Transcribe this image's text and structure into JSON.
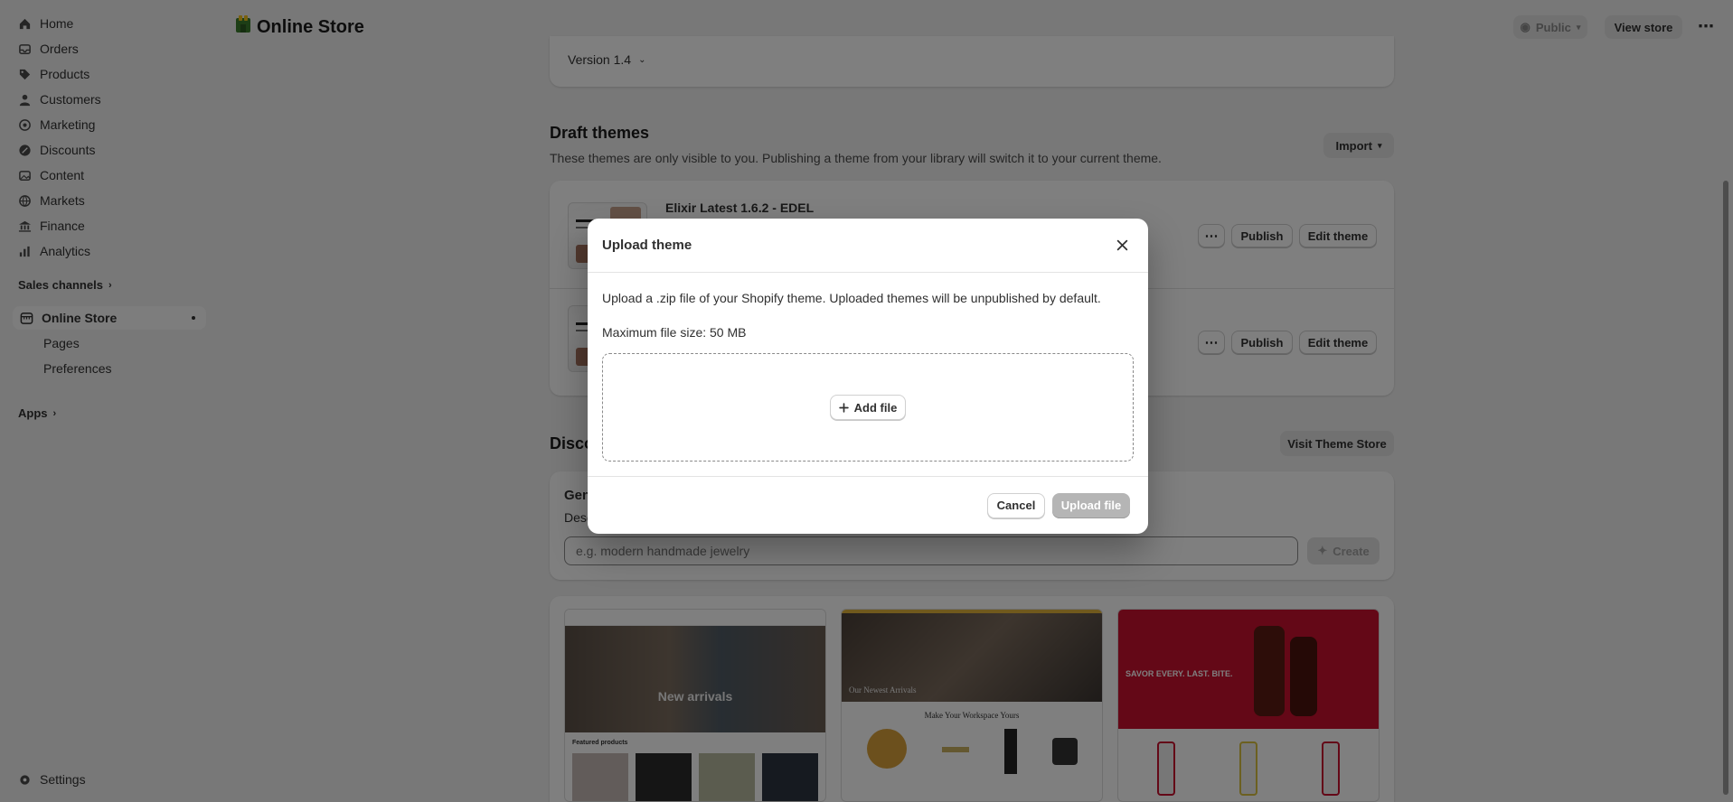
{
  "sidebar": {
    "items": [
      {
        "label": "Home",
        "icon": "home-icon"
      },
      {
        "label": "Orders",
        "icon": "inbox-icon"
      },
      {
        "label": "Products",
        "icon": "tag-icon"
      },
      {
        "label": "Customers",
        "icon": "person-icon"
      },
      {
        "label": "Marketing",
        "icon": "target-icon"
      },
      {
        "label": "Discounts",
        "icon": "discount-icon"
      },
      {
        "label": "Content",
        "icon": "image-icon"
      },
      {
        "label": "Markets",
        "icon": "globe-icon"
      },
      {
        "label": "Finance",
        "icon": "bank-icon"
      },
      {
        "label": "Analytics",
        "icon": "chart-icon"
      }
    ],
    "sales_channels_label": "Sales channels",
    "active_item": "Online Store",
    "sub_items": [
      "Pages",
      "Preferences"
    ],
    "apps_label": "Apps",
    "settings_label": "Settings"
  },
  "header": {
    "title": "Online Store",
    "visibility_label": "Public",
    "view_store_label": "View store",
    "more_label": "⋯"
  },
  "current_theme": {
    "version_label": "Version 1.4"
  },
  "draft_themes": {
    "title": "Draft themes",
    "description": "These themes are only visible to you. Publishing a theme from your library will switch it to your current theme.",
    "import_label": "Import",
    "themes": [
      {
        "name": "Elixir Latest 1.6.2 - EDEL",
        "publish_label": "Publish",
        "edit_label": "Edit theme",
        "more_label": "⋯"
      },
      {
        "name": "",
        "publish_label": "Publish",
        "edit_label": "Edit theme",
        "more_label": "⋯"
      }
    ]
  },
  "discover": {
    "title_partial": "Disco",
    "visit_store_label": "Visit Theme Store",
    "generate_title_partial": "Gen",
    "generate_desc_partial": "Desc",
    "prompt_placeholder": "e.g. modern handmade jewelry",
    "create_label": "Create",
    "cards": [
      {
        "headline": "New arrivals",
        "sub": "Featured products"
      },
      {
        "headline": "Our Newest Arrivals",
        "sub": "Make Your Workspace Yours"
      },
      {
        "headline": "SAVOR EVERY. LAST. BITE.",
        "sub": ""
      }
    ]
  },
  "modal": {
    "title": "Upload theme",
    "description": "Upload a .zip file of your Shopify theme. Uploaded themes will be unpublished by default.",
    "max_size": "Maximum file size: 50 MB",
    "add_file_label": "Add file",
    "cancel_label": "Cancel",
    "upload_label": "Upload file"
  },
  "colors": {
    "overlay": "rgba(0,0,0,0.5)",
    "upload_disabled": "#b5b5b5",
    "store_green": "#3a7d2c"
  }
}
